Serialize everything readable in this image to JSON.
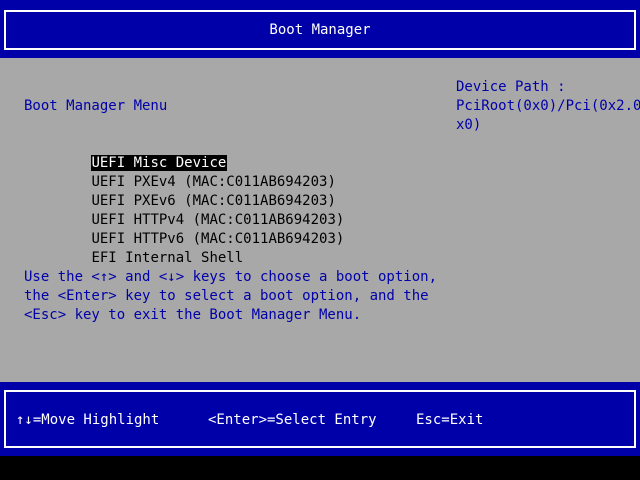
{
  "window": {
    "title": "Boot Manager"
  },
  "menu": {
    "title": "Boot Manager Menu",
    "items": [
      {
        "label": "UEFI Misc Device",
        "selected": true
      },
      {
        "label": "UEFI PXEv4 (MAC:C011AB694203)",
        "selected": false
      },
      {
        "label": "UEFI PXEv6 (MAC:C011AB694203)",
        "selected": false
      },
      {
        "label": "UEFI HTTPv4 (MAC:C011AB694203)",
        "selected": false
      },
      {
        "label": "UEFI HTTPv6 (MAC:C011AB694203)",
        "selected": false
      },
      {
        "label": "EFI Internal Shell",
        "selected": false
      }
    ]
  },
  "help": {
    "lines": [
      "Use the <↑> and <↓> keys to choose a boot option,",
      "the <Enter> key to select a boot option, and the",
      "<Esc> key to exit the Boot Manager Menu."
    ]
  },
  "device_path": {
    "lines": [
      "Device Path :",
      "PciRoot(0x0)/Pci(0x2.0",
      "x0)"
    ]
  },
  "footer": {
    "move": "↑↓=Move Highlight",
    "select": "<Enter>=Select Entry",
    "exit": "Esc=Exit"
  },
  "colors": {
    "bios_blue": "#0000a8",
    "panel_gray": "#a8a8a8",
    "text_white": "#ffffff",
    "text_black": "#000000"
  }
}
